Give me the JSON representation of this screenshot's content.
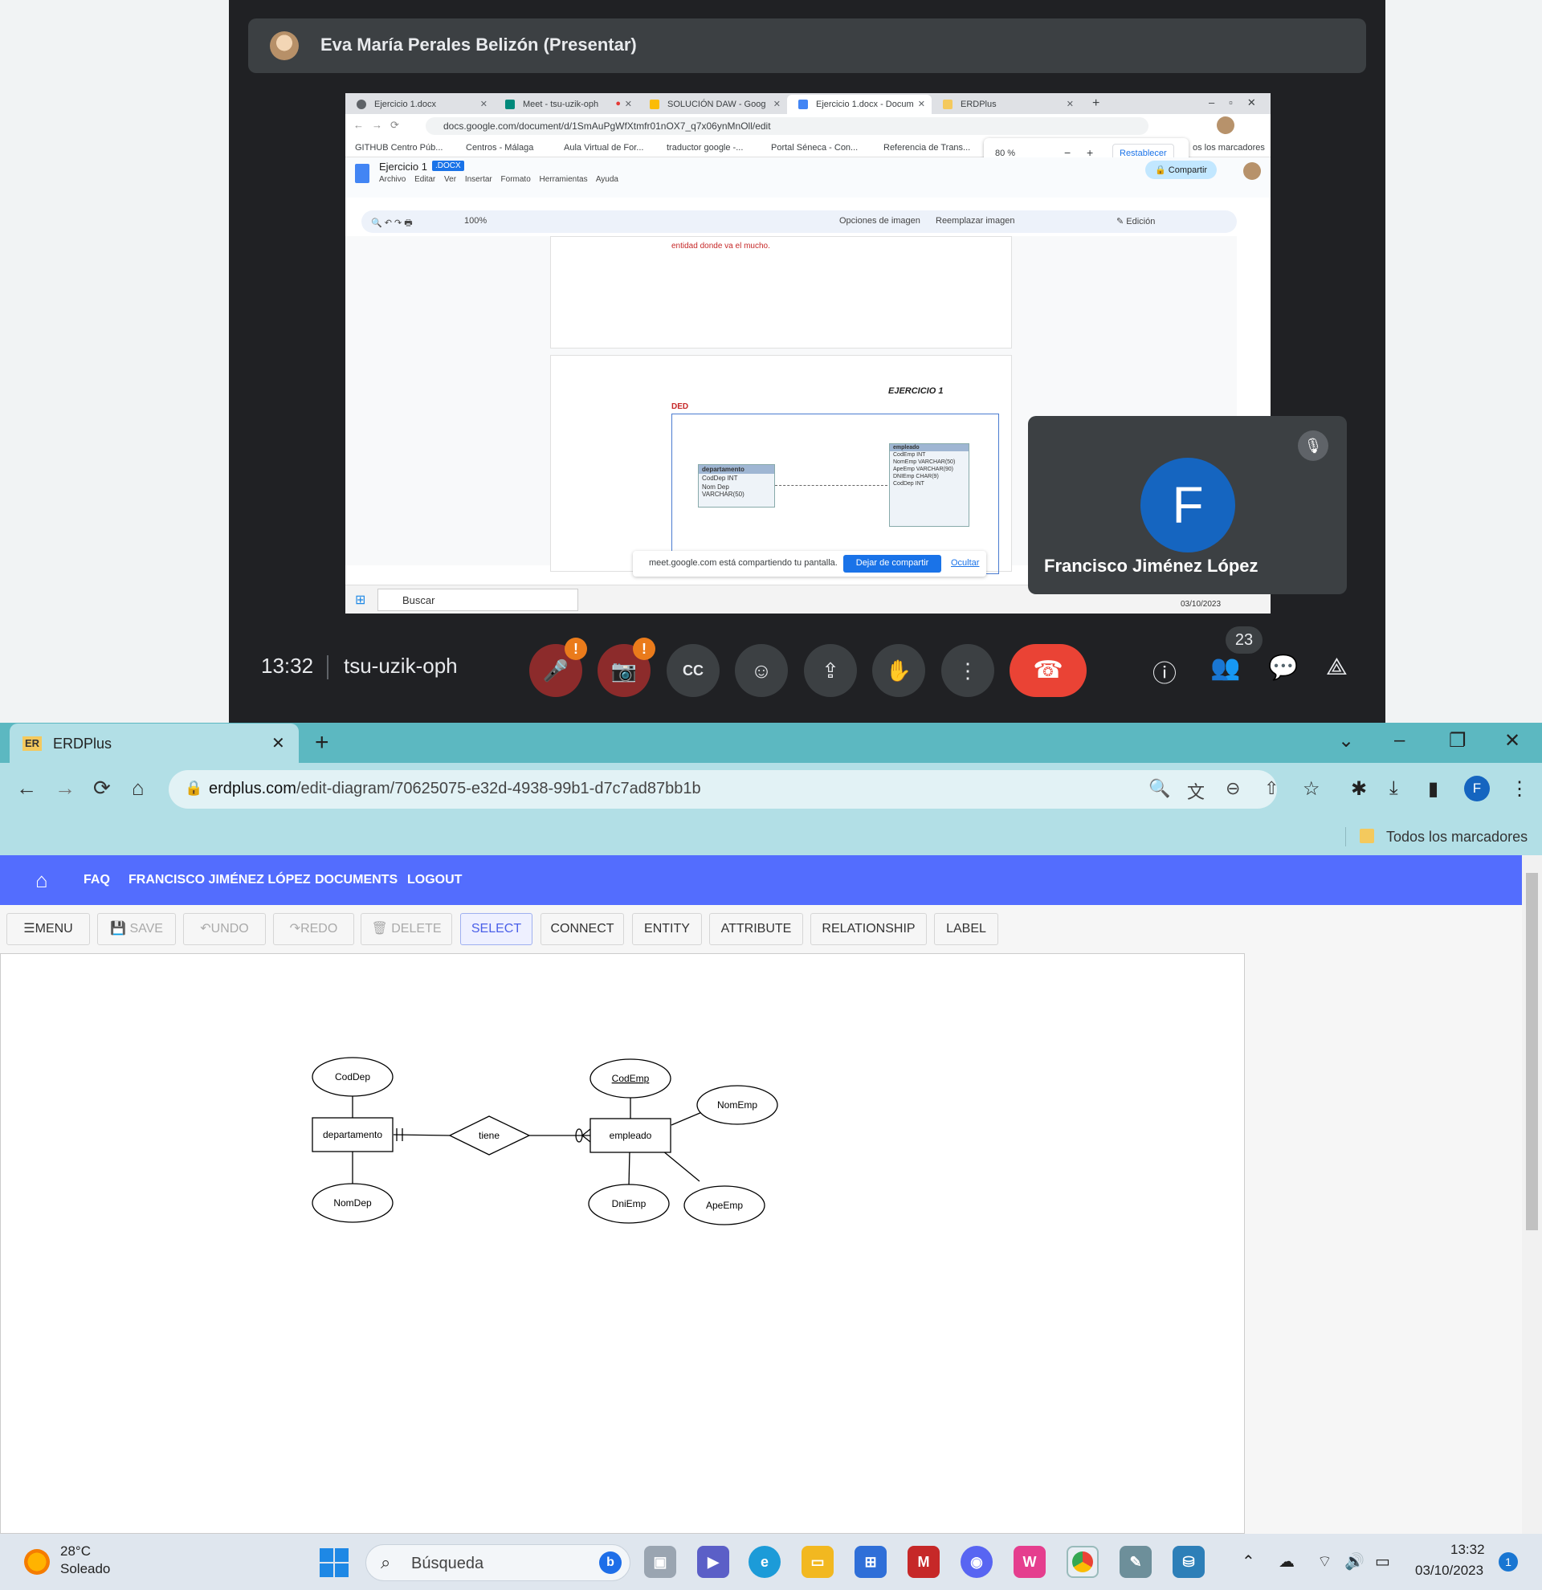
{
  "meet": {
    "presenter_name": "Eva María Perales Belizón (Presentar)",
    "shared_screen": {
      "tabs": [
        "Ejercicio 1.docx",
        "Meet - tsu-uzik-oph",
        "SOLUCIÓN DAW - Goog",
        "Ejercicio 1.docx - Docum",
        "ERDPlus"
      ],
      "url": "docs.google.com/document/d/1SmAuPgWfXtmfr01nOX7_q7x06ynMnOll/edit",
      "bookmarks": [
        "GITHUB Centro Púb...",
        "Centros - Málaga",
        "Aula Virtual de For...",
        "traductor google -...",
        "Portal Séneca - Con...",
        "Referencia de Trans...",
        "os los marcadores"
      ],
      "zoom_value": "80 %",
      "zoom_reset": "Restablecer",
      "doc_title": "Ejercicio 1",
      "doc_badge": ".DOCX",
      "doc_menus": [
        "Archivo",
        "Editar",
        "Ver",
        "Insertar",
        "Formato",
        "Herramientas",
        "Ayuda"
      ],
      "share_btn": "Compartir",
      "toolbar_zoom": "100%",
      "toolbar_img_opts": "Opciones de imagen",
      "toolbar_replace_img": "Reemplazar imagen",
      "toolbar_mode": "Edición",
      "doc_red_text": "entidad donde va el mucho.",
      "exercise_heading": "EJERCICIO 1",
      "ded_label": "DED",
      "mini_entity_1": "departamento",
      "mini_entity_1_attrs": [
        "CodDep INT",
        "Nom Dep VARCHAR(50)"
      ],
      "mini_entity_2": "empleado",
      "mini_entity_2_attrs": [
        "CodEmp INT",
        "NomEmp VARCHAR(50)",
        "ApeEmp VARCHAR(90)",
        "DNIEmp CHAR(9)",
        "CodDep INT"
      ],
      "share_notice": "meet.google.com está compartiendo tu pantalla.",
      "stop_share": "Dejar de compartir",
      "hide": "Ocultar",
      "taskbar_search": "Buscar",
      "taskbar_date": "03/10/2023"
    },
    "participant_tile": {
      "initial": "F",
      "name": "Francisco Jiménez López"
    },
    "time": "13:32",
    "meeting_code": "tsu-uzik-oph",
    "people_count": "23"
  },
  "browser": {
    "tab_icon": "ER",
    "tab_title": "ERDPlus",
    "url_host": "erdplus.com",
    "url_path": "/edit-diagram/70625075-e32d-4938-99b1-d7c7ad87bb1b",
    "profile_initial": "F",
    "bookmarks_folder": "Todos los marcadores"
  },
  "app": {
    "nav": [
      "FAQ",
      "FRANCISCO JIMÉNEZ LÓPEZ",
      "DOCUMENTS",
      "LOGOUT"
    ],
    "toolbar": {
      "menu": "MENU",
      "save": "SAVE",
      "undo": "UNDO",
      "redo": "REDO",
      "delete": "DELETE",
      "select": "SELECT",
      "connect": "CONNECT",
      "entity": "ENTITY",
      "attribute": "ATTRIBUTE",
      "relationship": "RELATIONSHIP",
      "label": "LABEL"
    },
    "diagram": {
      "entities": [
        "departamento",
        "empleado"
      ],
      "relationship": "tiene",
      "attributes_departamento": [
        "CodDep",
        "NomDep"
      ],
      "attributes_empleado": [
        "CodEmp",
        "NomEmp",
        "ApeEmp",
        "DniEmp"
      ]
    }
  },
  "taskbar": {
    "temperature": "28°C",
    "weather": "Soleado",
    "search": "Búsqueda",
    "time": "13:32",
    "date": "03/10/2023",
    "notifications": "1"
  }
}
